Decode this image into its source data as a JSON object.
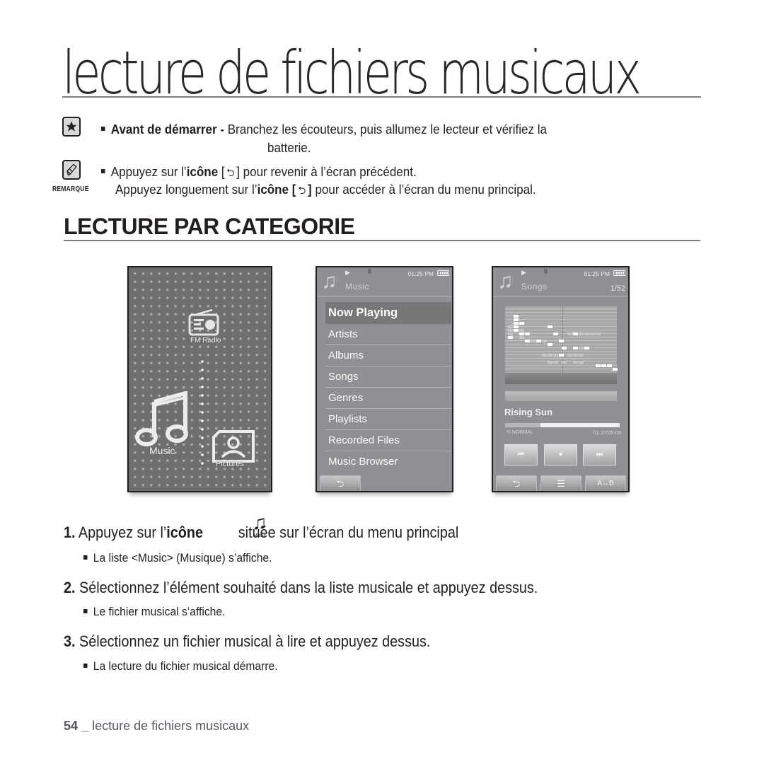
{
  "page": {
    "chapter_title": "lecture de fichiers musicaux",
    "section_title": "LECTURE PAR CATEGORIE",
    "footer": {
      "page_number": "54",
      "separator": "_",
      "chapter": "lecture de fichiers musicaux"
    }
  },
  "notes": {
    "star_icon": "star-icon",
    "remarque_label": "REMARQUE",
    "before_start": {
      "label": "Avant de démarrer -",
      "text_line1": "Branchez les écouteurs, puis allumez le lecteur et vérifiez la",
      "text_line2": "batterie."
    },
    "back_short": {
      "prefix": "Appuyez sur l’",
      "bold": "icône",
      "suffix": "pour revenir à l’écran précédent."
    },
    "back_long": {
      "prefix": "Appuyez longuement sur l’",
      "bold": "icône",
      "suffix": "pour accéder à l’écran du menu principal."
    },
    "back_glyph": "⮌"
  },
  "screens": {
    "home": {
      "items": [
        {
          "label": "FM Radio",
          "icon": "radio-icon"
        },
        {
          "label": "Music",
          "icon": "music-note-icon"
        },
        {
          "label": "Pictures",
          "icon": "pictures-icon"
        }
      ]
    },
    "music_list": {
      "time": "01:25 PM",
      "title": "Music",
      "selected_index": 0,
      "items": [
        "Now Playing",
        "Artists",
        "Albums",
        "Songs",
        "Genres",
        "Playlists",
        "Recorded Files",
        "Music Browser"
      ],
      "back_label": "⮌"
    },
    "player": {
      "time": "01:25 PM",
      "title": "Songs",
      "count": "1/52",
      "track_title": "Rising Sun",
      "repeat_mode": "NORMAL",
      "elapsed_total": "01:37/05:09",
      "progress_fraction": 0.31,
      "controls": {
        "prev": "⏮",
        "pause": "⏸",
        "next": "⏭"
      },
      "bottom": {
        "back": "⮌",
        "list": "☰",
        "ab": "A↔B"
      }
    }
  },
  "steps": [
    {
      "number": "1.",
      "text_prefix": "Appuyez sur l’",
      "text_bold": "icône",
      "text_suffix": "située sur l’écran du menu principal",
      "icon_caption": "Music",
      "sub": "La liste <Music> (Musique) s’affiche."
    },
    {
      "number": "2.",
      "text": "Sélectionnez l’élément souhaité dans la liste musicale et appuyez dessus.",
      "sub": "Le fichier musical s’affiche."
    },
    {
      "number": "3.",
      "text": "Sélectionnez un fichier musical à lire et appuyez dessus.",
      "sub": "La lecture du fichier musical démarre."
    }
  ]
}
